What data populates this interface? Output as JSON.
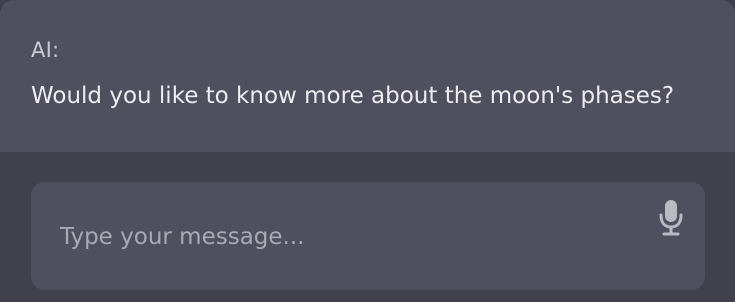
{
  "conversation": {
    "sender_label": "AI:",
    "message": "Would you like to know more about the moon's phases?"
  },
  "composer": {
    "placeholder": "Type your message...",
    "value": "",
    "mic_icon": "microphone-icon"
  },
  "colors": {
    "message_bg": "#4f505e",
    "page_bg": "#41414d",
    "text": "#ececf1",
    "muted_text": "#a9a9b4"
  }
}
